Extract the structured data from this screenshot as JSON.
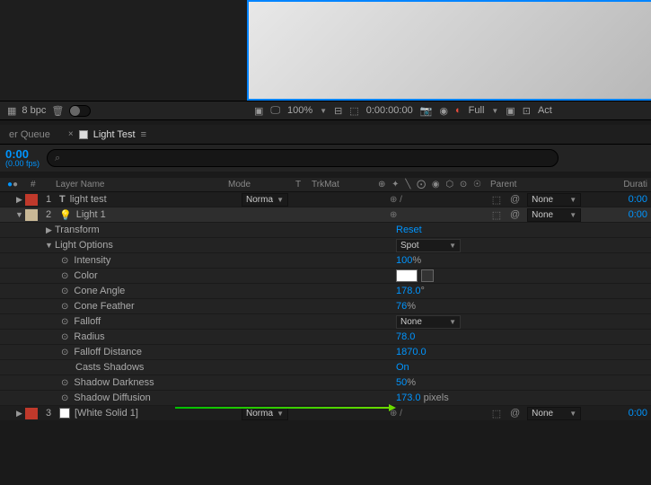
{
  "preview": {
    "zoom": "100%",
    "timecode": "0:00:00:00",
    "resolution": "Full",
    "activecam": "Act"
  },
  "bpc_bar": {
    "bpc": "8 bpc"
  },
  "tabs": {
    "queue": "er Queue",
    "active": "Light Test"
  },
  "time": {
    "code": "0:00",
    "fps": "(0.00 fps)"
  },
  "search": {
    "placeholder": "⌕"
  },
  "headers": {
    "tag": "⬤",
    "num": "#",
    "name": "Layer Name",
    "mode": "Mode",
    "t": "T",
    "trk": "TrkMat",
    "switches": "⊕ ✦ ╲ ⨀ ◉ ⬡ ⊙ ☉",
    "parent": "Parent",
    "dur": "Durati"
  },
  "layers": [
    {
      "num": "1",
      "name": "light test",
      "type_icon": "T",
      "mode": "Norma",
      "parent": "None",
      "duration": "0:00",
      "color": "red",
      "sw": "⊕ /"
    },
    {
      "num": "2",
      "name": "Light 1",
      "type_icon": "bulb",
      "parent": "None",
      "duration": "0:00",
      "color": "tan",
      "sw": "⊕"
    },
    {
      "num": "3",
      "name": "[White Solid 1]",
      "type_icon": "solid",
      "mode": "Norma",
      "parent": "None",
      "duration": "0:00",
      "color": "red",
      "sw": "⊕ /"
    }
  ],
  "transform_label": "Transform",
  "transform_value": "Reset",
  "lightopts": {
    "header": "Light Options",
    "type": "Spot",
    "props": [
      {
        "label": "Intensity",
        "value": "100",
        "unit": "%"
      },
      {
        "label": "Color",
        "value": "swatch"
      },
      {
        "label": "Cone Angle",
        "value": "178.0",
        "unit": "°"
      },
      {
        "label": "Cone Feather",
        "value": "76",
        "unit": "%"
      },
      {
        "label": "Falloff",
        "value": "None",
        "dd": true
      },
      {
        "label": "Radius",
        "value": "78.0"
      },
      {
        "label": "Falloff Distance",
        "value": "1870.0"
      },
      {
        "label": "Casts Shadows",
        "value": "On",
        "nostop": true
      },
      {
        "label": "Shadow Darkness",
        "value": "50",
        "unit": "%"
      },
      {
        "label": "Shadow Diffusion",
        "value": "173.0",
        "unit": " pixels"
      }
    ]
  }
}
